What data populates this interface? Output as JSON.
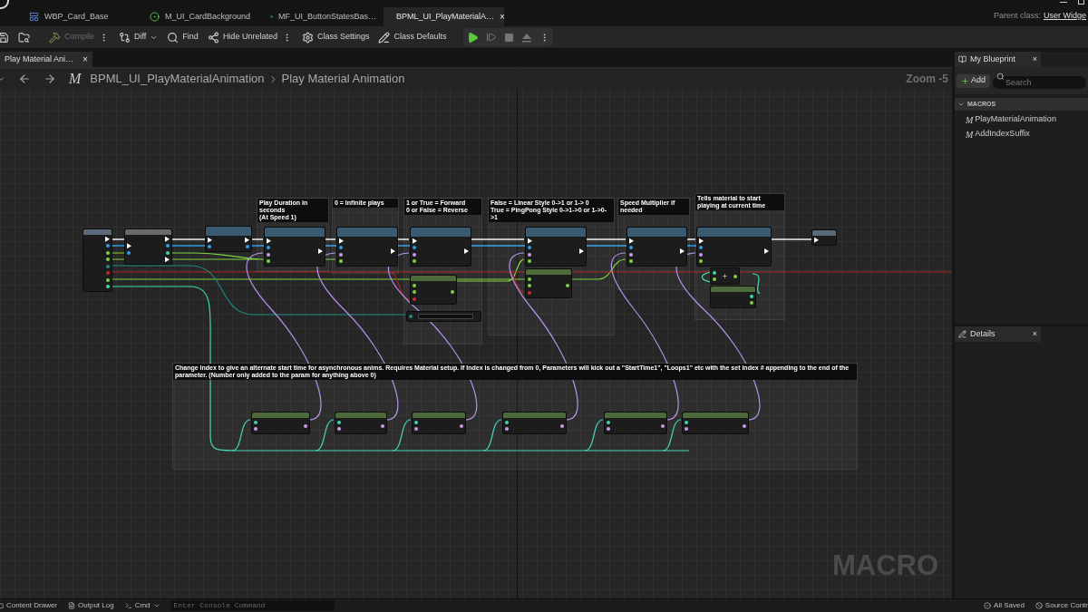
{
  "document_tabs": [
    {
      "label": "WBP_Card_Base",
      "kind": "widget",
      "selected": false
    },
    {
      "label": "M_UI_CardBackground",
      "kind": "material",
      "selected": false
    },
    {
      "label": "MF_UI_ButtonStatesBas…",
      "kind": "function",
      "selected": false
    },
    {
      "label": "BPML_UI_PlayMaterialA…",
      "kind": "library",
      "selected": true,
      "close": "×"
    }
  ],
  "parent_class": {
    "label": "Parent class:",
    "value": "User Widge"
  },
  "toolbar": [
    {
      "label": "Compile",
      "kind": "compile",
      "disabled": true
    },
    {
      "label": "Diff",
      "kind": "diff",
      "disabled": false
    },
    {
      "label": "Find",
      "kind": "find",
      "disabled": false
    },
    {
      "label": "Hide Unrelated",
      "kind": "hide",
      "disabled": false
    },
    {
      "label": "Class Settings",
      "kind": "settings",
      "disabled": false
    },
    {
      "label": "Class Defaults",
      "kind": "defaults",
      "disabled": false
    }
  ],
  "graph_tab": {
    "label": "Play Material Ani…",
    "close": "×",
    "selected": true
  },
  "breadcrumb": {
    "icon": "M",
    "items": [
      "BPML_UI_PlayMaterialAnimation",
      "Play Material Animation"
    ]
  },
  "zoom": "Zoom -5",
  "graph_type": "MACRO",
  "comments": [
    "Play Duration in seconds\n(At Speed 1)",
    "0 = Infinite plays",
    "1 or True = Forward\n0 or False = Reverse",
    "False = Linear Style 0->1 or 1-> 0\nTrue = PingPong Style 0->1->0 or 1->0->1",
    "Speed Multiplier if needed",
    "Tells material to start playing at current time",
    "Change Index to give an alternate start time for asynchronous anims. Requires Material setup. If Index is changed from 0, Parameters will kick out a \"StartTime1\", \"Loops1\" etc with the set index # appending to the end of the parameter. (Number only added to the param for anything above 0)"
  ],
  "nodes": [
    {
      "kind": "tunnel",
      "outputs": [
        {
          "kind": "exec"
        },
        {
          "kind": "object"
        },
        {
          "kind": "float"
        },
        {
          "kind": "float"
        },
        {
          "kind": "byte"
        },
        {
          "kind": "bool"
        },
        {
          "kind": "float"
        },
        {
          "kind": "int"
        }
      ]
    },
    {
      "kind": "macro",
      "inputs": [
        {
          "kind": "exec"
        },
        {
          "kind": "object"
        }
      ],
      "outputs": [
        {
          "kind": "exec"
        },
        {
          "kind": "object"
        },
        {
          "kind": "int"
        },
        {
          "kind": "exec"
        }
      ]
    },
    {
      "kind": "function",
      "inputs": [
        {
          "kind": "exec"
        },
        {
          "kind": "object"
        }
      ],
      "outputs": [
        {
          "kind": "exec"
        },
        {
          "kind": "object"
        }
      ]
    },
    {
      "kind": "function",
      "inputs": [
        {
          "kind": "exec"
        },
        {
          "kind": "object"
        },
        {
          "kind": "name"
        },
        {
          "kind": "float"
        }
      ],
      "outputs": [
        {
          "kind": "exec"
        }
      ]
    },
    {
      "kind": "function",
      "inputs": [
        {
          "kind": "exec"
        },
        {
          "kind": "object"
        },
        {
          "kind": "name"
        },
        {
          "kind": "float"
        }
      ],
      "outputs": [
        {
          "kind": "exec"
        }
      ]
    },
    {
      "kind": "function",
      "inputs": [
        {
          "kind": "exec"
        },
        {
          "kind": "object"
        },
        {
          "kind": "name"
        },
        {
          "kind": "float"
        }
      ],
      "outputs": [
        {
          "kind": "exec"
        }
      ]
    },
    {
      "kind": "function",
      "inputs": [
        {
          "kind": "exec"
        },
        {
          "kind": "object"
        },
        {
          "kind": "name"
        },
        {
          "kind": "float"
        }
      ],
      "outputs": [
        {
          "kind": "exec"
        }
      ]
    },
    {
      "kind": "function",
      "inputs": [
        {
          "kind": "exec"
        },
        {
          "kind": "object"
        },
        {
          "kind": "name"
        },
        {
          "kind": "float"
        }
      ],
      "outputs": [
        {
          "kind": "exec"
        }
      ]
    },
    {
      "kind": "function",
      "inputs": [
        {
          "kind": "exec"
        },
        {
          "kind": "object"
        },
        {
          "kind": "name"
        },
        {
          "kind": "float"
        }
      ],
      "outputs": [
        {
          "kind": "exec"
        }
      ]
    },
    {
      "kind": "pure",
      "inputs": [
        {
          "kind": "float"
        },
        {
          "kind": "float"
        },
        {
          "kind": "bool"
        }
      ],
      "outputs": [
        {
          "kind": "float"
        }
      ]
    },
    {
      "kind": "pure",
      "inputs": [
        {
          "kind": "float"
        },
        {
          "kind": "float"
        },
        {
          "kind": "bool"
        }
      ],
      "outputs": [
        {
          "kind": "float"
        }
      ]
    },
    {
      "kind": "select",
      "inputs": [
        {
          "kind": "byte"
        }
      ]
    },
    {
      "kind": "compact",
      "inputs": [
        {
          "kind": "int"
        },
        {
          "kind": "float"
        }
      ],
      "outputs": [
        {
          "kind": "float"
        }
      ]
    },
    {
      "kind": "pure",
      "outputs": [
        {
          "kind": "int"
        },
        {
          "kind": "float"
        }
      ]
    },
    {
      "kind": "tunnel",
      "inputs": [
        {
          "kind": "exec"
        }
      ]
    },
    {
      "kind": "pure",
      "inputs": [
        {
          "kind": "int"
        },
        {
          "kind": "name"
        }
      ],
      "outputs": [
        {
          "kind": "name"
        }
      ]
    },
    {
      "kind": "pure",
      "inputs": [
        {
          "kind": "int"
        },
        {
          "kind": "name"
        }
      ],
      "outputs": [
        {
          "kind": "name"
        }
      ]
    },
    {
      "kind": "pure",
      "inputs": [
        {
          "kind": "int"
        },
        {
          "kind": "name"
        }
      ],
      "outputs": [
        {
          "kind": "name"
        }
      ]
    },
    {
      "kind": "pure",
      "inputs": [
        {
          "kind": "int"
        },
        {
          "kind": "name"
        }
      ],
      "outputs": [
        {
          "kind": "name"
        }
      ]
    },
    {
      "kind": "pure",
      "inputs": [
        {
          "kind": "int"
        },
        {
          "kind": "name"
        }
      ],
      "outputs": [
        {
          "kind": "name"
        }
      ]
    },
    {
      "kind": "pure",
      "inputs": [
        {
          "kind": "int"
        },
        {
          "kind": "name"
        }
      ],
      "outputs": [
        {
          "kind": "name"
        }
      ]
    }
  ],
  "my_blueprint": {
    "title": "My Blueprint",
    "close": "×",
    "add": "Add",
    "search_placeholder": "Search",
    "section": "MACROS",
    "items": [
      {
        "icon": "M",
        "label": "PlayMaterialAnimation",
        "selected": false
      },
      {
        "icon": "M",
        "label": "AddIndexSuffix",
        "selected": false
      }
    ]
  },
  "details": {
    "title": "Details",
    "close": "×"
  },
  "status_bar": {
    "content_drawer": "Content Drawer",
    "output_log": "Output Log",
    "cmd": "Cmd",
    "console_placeholder": "Enter Console Command",
    "saved": "All Saved",
    "source_control": "Source Contr"
  }
}
